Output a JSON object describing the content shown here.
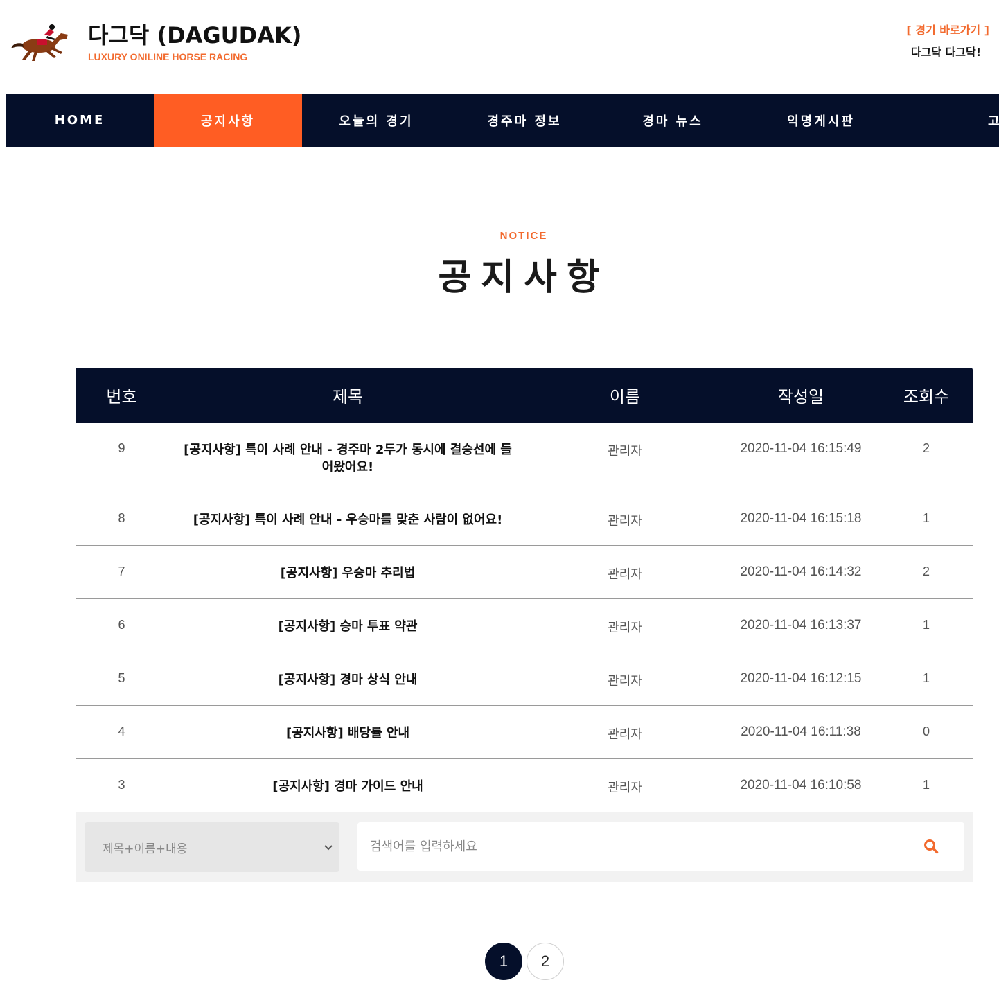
{
  "brand": {
    "title": "다그닥 (DAGUDAK)",
    "subtitle": "LUXURY ONILINE HORSE RACING",
    "quick_link": "[ 경기 바로가기 ]",
    "quick_sub": "다그닥 다그닥!",
    "accent_color": "#f26a2e",
    "logo_icon": "horse-jockey-icon"
  },
  "nav": {
    "items": [
      {
        "label": "HOME"
      },
      {
        "label": "공지사항",
        "active": true
      },
      {
        "label": "오늘의 경기"
      },
      {
        "label": "경주마 정보"
      },
      {
        "label": "경마 뉴스"
      },
      {
        "label": "익명게시판"
      },
      {
        "label": "고객센터"
      }
    ],
    "bg_color": "#050f2a",
    "active_color": "#ff5d23"
  },
  "section": {
    "eyebrow": "NOTICE",
    "title": "공지사항"
  },
  "table": {
    "headers": {
      "no": "번호",
      "title": "제목",
      "name": "이름",
      "date": "작성일",
      "views": "조회수"
    },
    "rows": [
      {
        "no": "9",
        "title": "[공지사항] 특이 사례 안내 -  경주마 2두가 동시에 결승선에 들어왔어요!",
        "name": "관리자",
        "date": "2020-11-04 16:15:49",
        "views": "2"
      },
      {
        "no": "8",
        "title": "[공지사항] 특이 사례 안내 - 우승마를 맞춘 사람이 없어요!",
        "name": "관리자",
        "date": "2020-11-04 16:15:18",
        "views": "1"
      },
      {
        "no": "7",
        "title": "[공지사항] 우승마 추리법",
        "name": "관리자",
        "date": "2020-11-04 16:14:32",
        "views": "2"
      },
      {
        "no": "6",
        "title": "[공지사항] 승마 투표 약관",
        "name": "관리자",
        "date": "2020-11-04 16:13:37",
        "views": "1"
      },
      {
        "no": "5",
        "title": "[공지사항] 경마 상식 안내",
        "name": "관리자",
        "date": "2020-11-04 16:12:15",
        "views": "1"
      },
      {
        "no": "4",
        "title": "[공지사항] 배당률 안내",
        "name": "관리자",
        "date": "2020-11-04 16:11:38",
        "views": "0"
      },
      {
        "no": "3",
        "title": "[공지사항] 경마 가이드 안내",
        "name": "관리자",
        "date": "2020-11-04 16:10:58",
        "views": "1"
      }
    ]
  },
  "search": {
    "select_value": "제목+이름+내용",
    "placeholder": "검색어를 입력하세요",
    "select_icon": "chevron-down-icon",
    "submit_icon": "search-icon"
  },
  "pagination": {
    "pages": [
      "1",
      "2"
    ],
    "current": "1"
  }
}
